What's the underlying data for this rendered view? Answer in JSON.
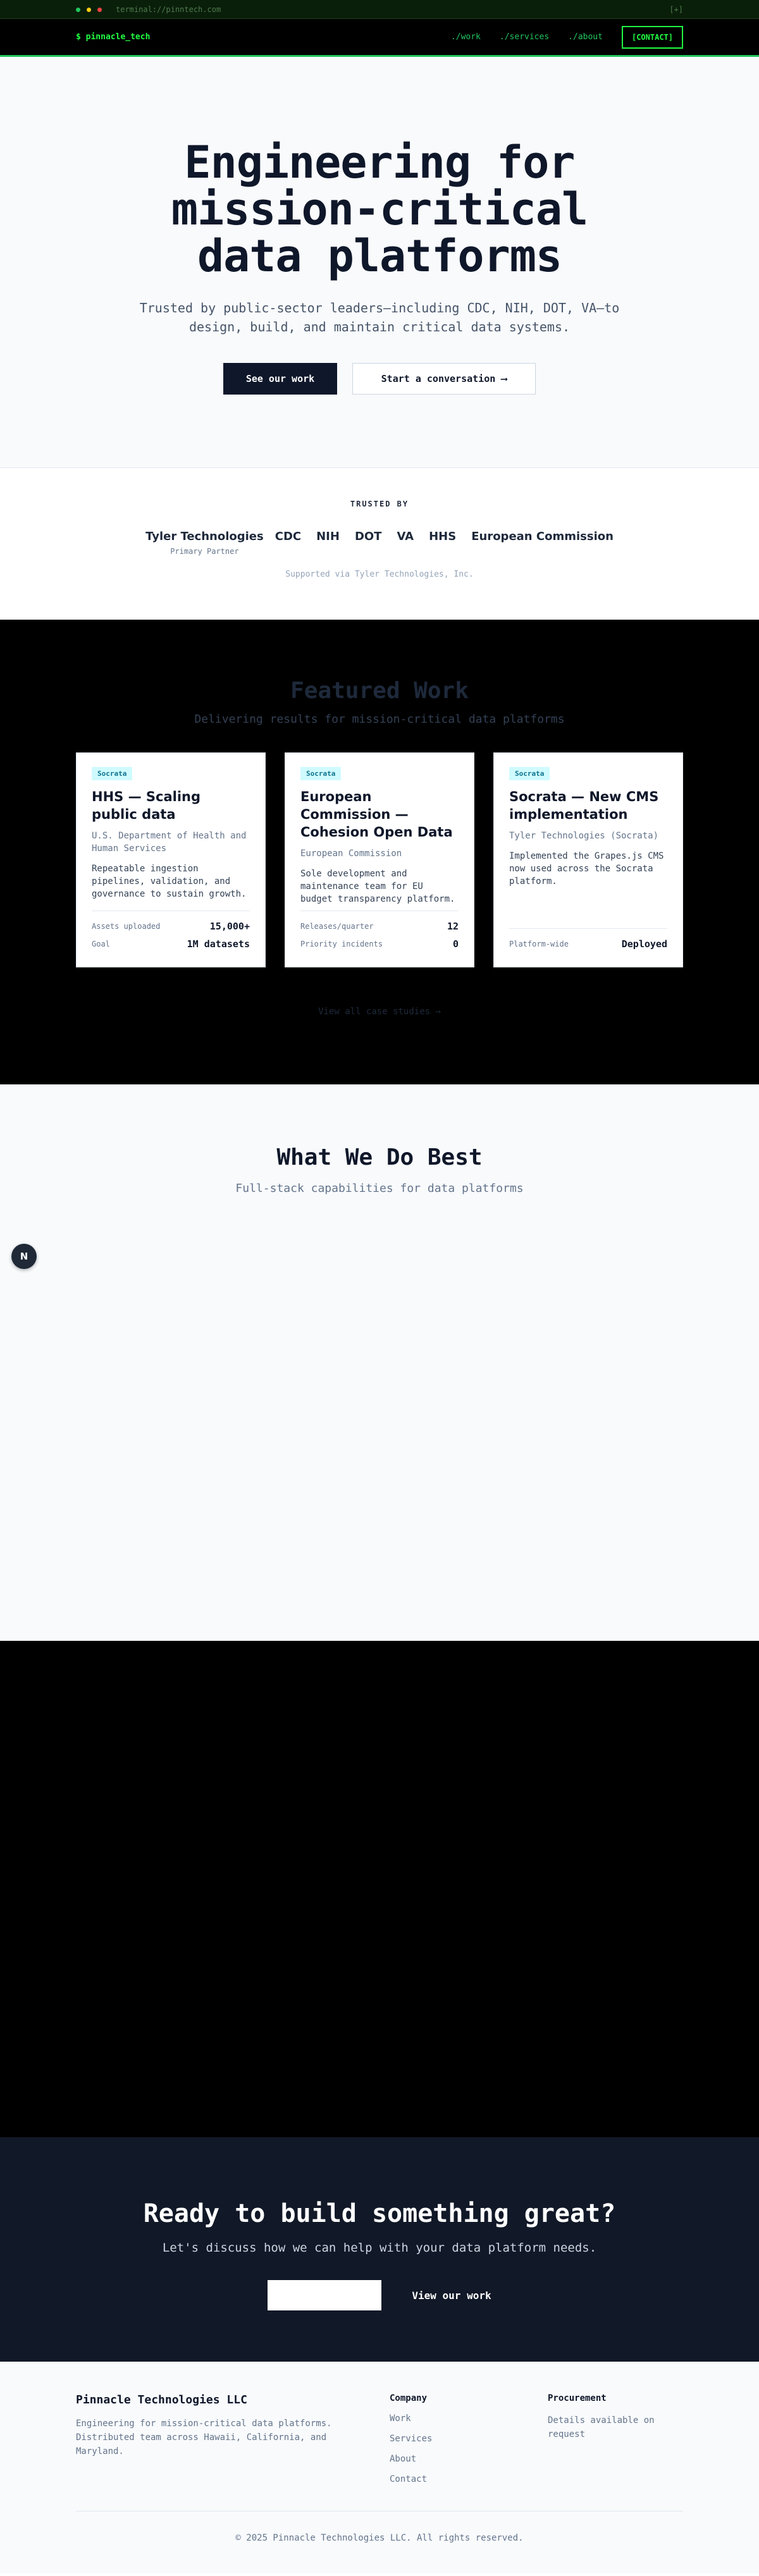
{
  "terminal": {
    "url": "terminal://pinntech.com",
    "expand": "[+]"
  },
  "nav": {
    "brand": "$ pinnacle_tech",
    "links": [
      "./work",
      "./services",
      "./about"
    ],
    "cta": "[CONTACT]"
  },
  "hero": {
    "title": "Engineering for mission-critical data platforms",
    "subtitle": "Trusted by public-sector leaders—including CDC, NIH, DOT, VA—to design, build, and maintain critical data systems.",
    "primary_button": "See our work",
    "secondary_button": "Start a conversation ⟶"
  },
  "trusted": {
    "label": "TRUSTED BY",
    "partner": {
      "name": "Tyler Technologies",
      "sub": "Primary Partner"
    },
    "logos": [
      "CDC",
      "NIH",
      "DOT",
      "VA",
      "HHS",
      "European Commission"
    ],
    "note": "Supported via Tyler Technologies, Inc."
  },
  "featured": {
    "title": "Featured Work",
    "subtitle": "Delivering results for mission-critical data platforms",
    "cards": [
      {
        "badge": "Socrata",
        "title": "HHS — Scaling public data",
        "client": "U.S. Department of Health and Human Services",
        "desc": "Repeatable ingestion pipelines, validation, and governance to sustain growth.",
        "stats": [
          {
            "k": "Assets uploaded",
            "v": "15,000+"
          },
          {
            "k": "Goal",
            "v": "1M datasets"
          }
        ]
      },
      {
        "badge": "Socrata",
        "title": "European Commission — Cohesion Open Data",
        "client": "European Commission",
        "desc": "Sole development and maintenance team for EU budget transparency platform.",
        "stats": [
          {
            "k": "Releases/quarter",
            "v": "12"
          },
          {
            "k": "Priority incidents",
            "v": "0"
          }
        ]
      },
      {
        "badge": "Socrata",
        "title": "Socrata — New CMS implementation",
        "client": "Tyler Technologies (Socrata)",
        "desc": "Implemented the Grapes.js CMS now used across the Socrata platform.",
        "stats": [
          {
            "k": "Platform-wide",
            "v": "Deployed"
          }
        ]
      }
    ],
    "view_all": "View all case studies →"
  },
  "whatwedo": {
    "title": "What We Do Best",
    "subtitle": "Full-stack capabilities for data platforms",
    "fab": "N"
  },
  "cta": {
    "title": "Ready to build something great?",
    "subtitle": "Let's discuss how we can help with your data platform needs.",
    "primary_button": "",
    "secondary_button": "View our work"
  },
  "footer": {
    "company": "Pinnacle Technologies LLC",
    "tagline": "Engineering for mission-critical data platforms. Distributed team across Hawaii, California, and Maryland.",
    "company_heading": "Company",
    "company_links": [
      "Work",
      "Services",
      "About",
      "Contact"
    ],
    "procurement_heading": "Procurement",
    "procurement_text": "Details available on request",
    "copyright": "© 2025 Pinnacle Technologies LLC. All rights reserved."
  },
  "colors": {
    "accent": "#22c55e",
    "brand_green": "#22ff44",
    "dark_navy": "#0f172a",
    "badge_bg": "#cffafe"
  }
}
